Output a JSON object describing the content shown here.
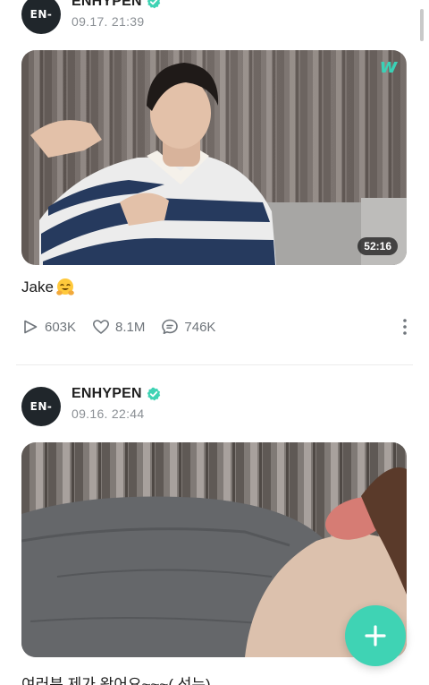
{
  "posts": [
    {
      "author": "ENHYPEN",
      "avatar_text": "EN-",
      "timestamp": "09.17. 21:39",
      "has_video": true,
      "video_duration": "52:16",
      "caption": "Jake",
      "caption_emoji": "hugging-face-emoji",
      "stats": {
        "plays": "603K",
        "likes": "8.1M",
        "comments": "746K"
      }
    },
    {
      "author": "ENHYPEN",
      "avatar_text": "EN-",
      "timestamp": "09.16. 22:44",
      "caption": "여러분 제가 왔어요~~~( 선누)"
    }
  ],
  "overlay_logo": "w",
  "colors": {
    "accent": "#3fd3b4",
    "verified": "#3fd3b4",
    "meta_text": "#8a8f94",
    "avatar_bg": "#20262b"
  },
  "icons": {
    "verified": "verified-badge-icon",
    "plays": "play-icon",
    "likes": "heart-icon",
    "comments": "comment-icon",
    "more": "more-vertical-icon",
    "fab": "plus-icon"
  }
}
